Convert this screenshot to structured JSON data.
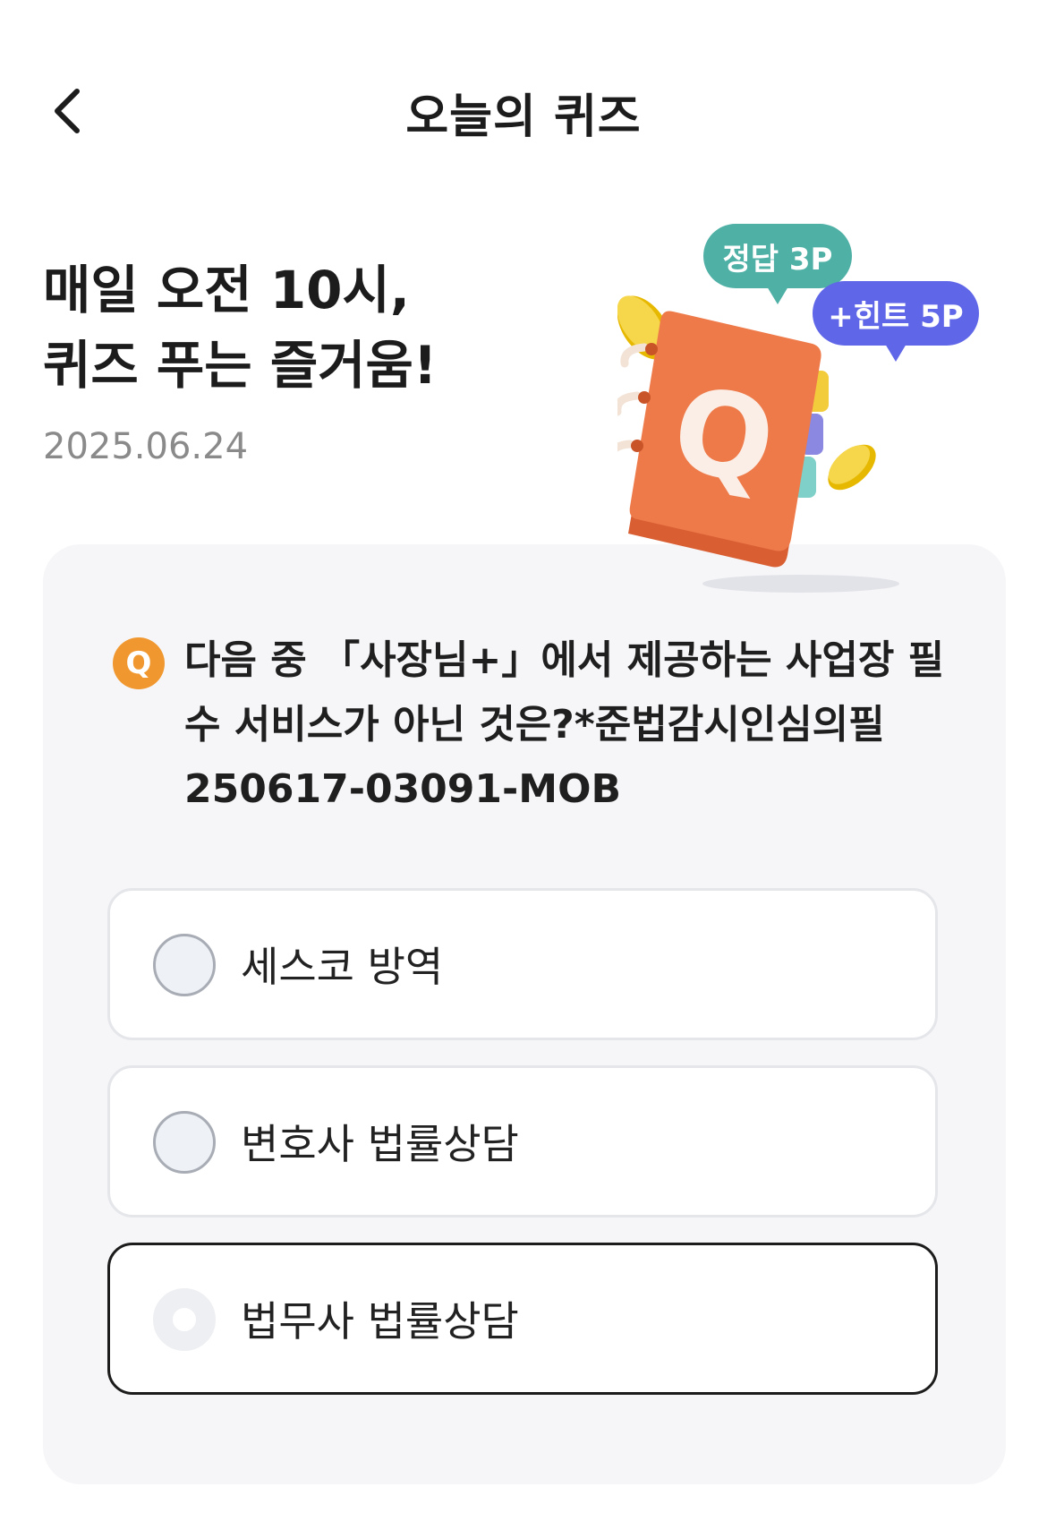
{
  "header": {
    "title": "오늘의 퀴즈",
    "back_icon": "chevron-left-icon"
  },
  "hero": {
    "title_line1": "매일 오전 10시,",
    "title_line2": "퀴즈 푸는 즐거움!",
    "date": "2025.06.24"
  },
  "illustration": {
    "answer_badge": "정답 3P",
    "hint_badge": "+힌트 5P",
    "book_letter": "Q",
    "colors": {
      "answer_bubble": "#4fb0a6",
      "hint_bubble": "#5f66e8",
      "book": "#ee7a4a",
      "coin": "#f4cf3a"
    }
  },
  "quiz": {
    "q_badge": "Q",
    "question": "다음 중 「사장님+」에서 제공하는 사업장 필수 서비스가 아닌 것은?*준법감시인심의필 250617-03091-MOB",
    "options": [
      {
        "label": "세스코 방역",
        "selected": false
      },
      {
        "label": "변호사 법률상담",
        "selected": false
      },
      {
        "label": "법무사 법률상담",
        "selected": true
      }
    ],
    "accent_color": "#f0982f"
  }
}
